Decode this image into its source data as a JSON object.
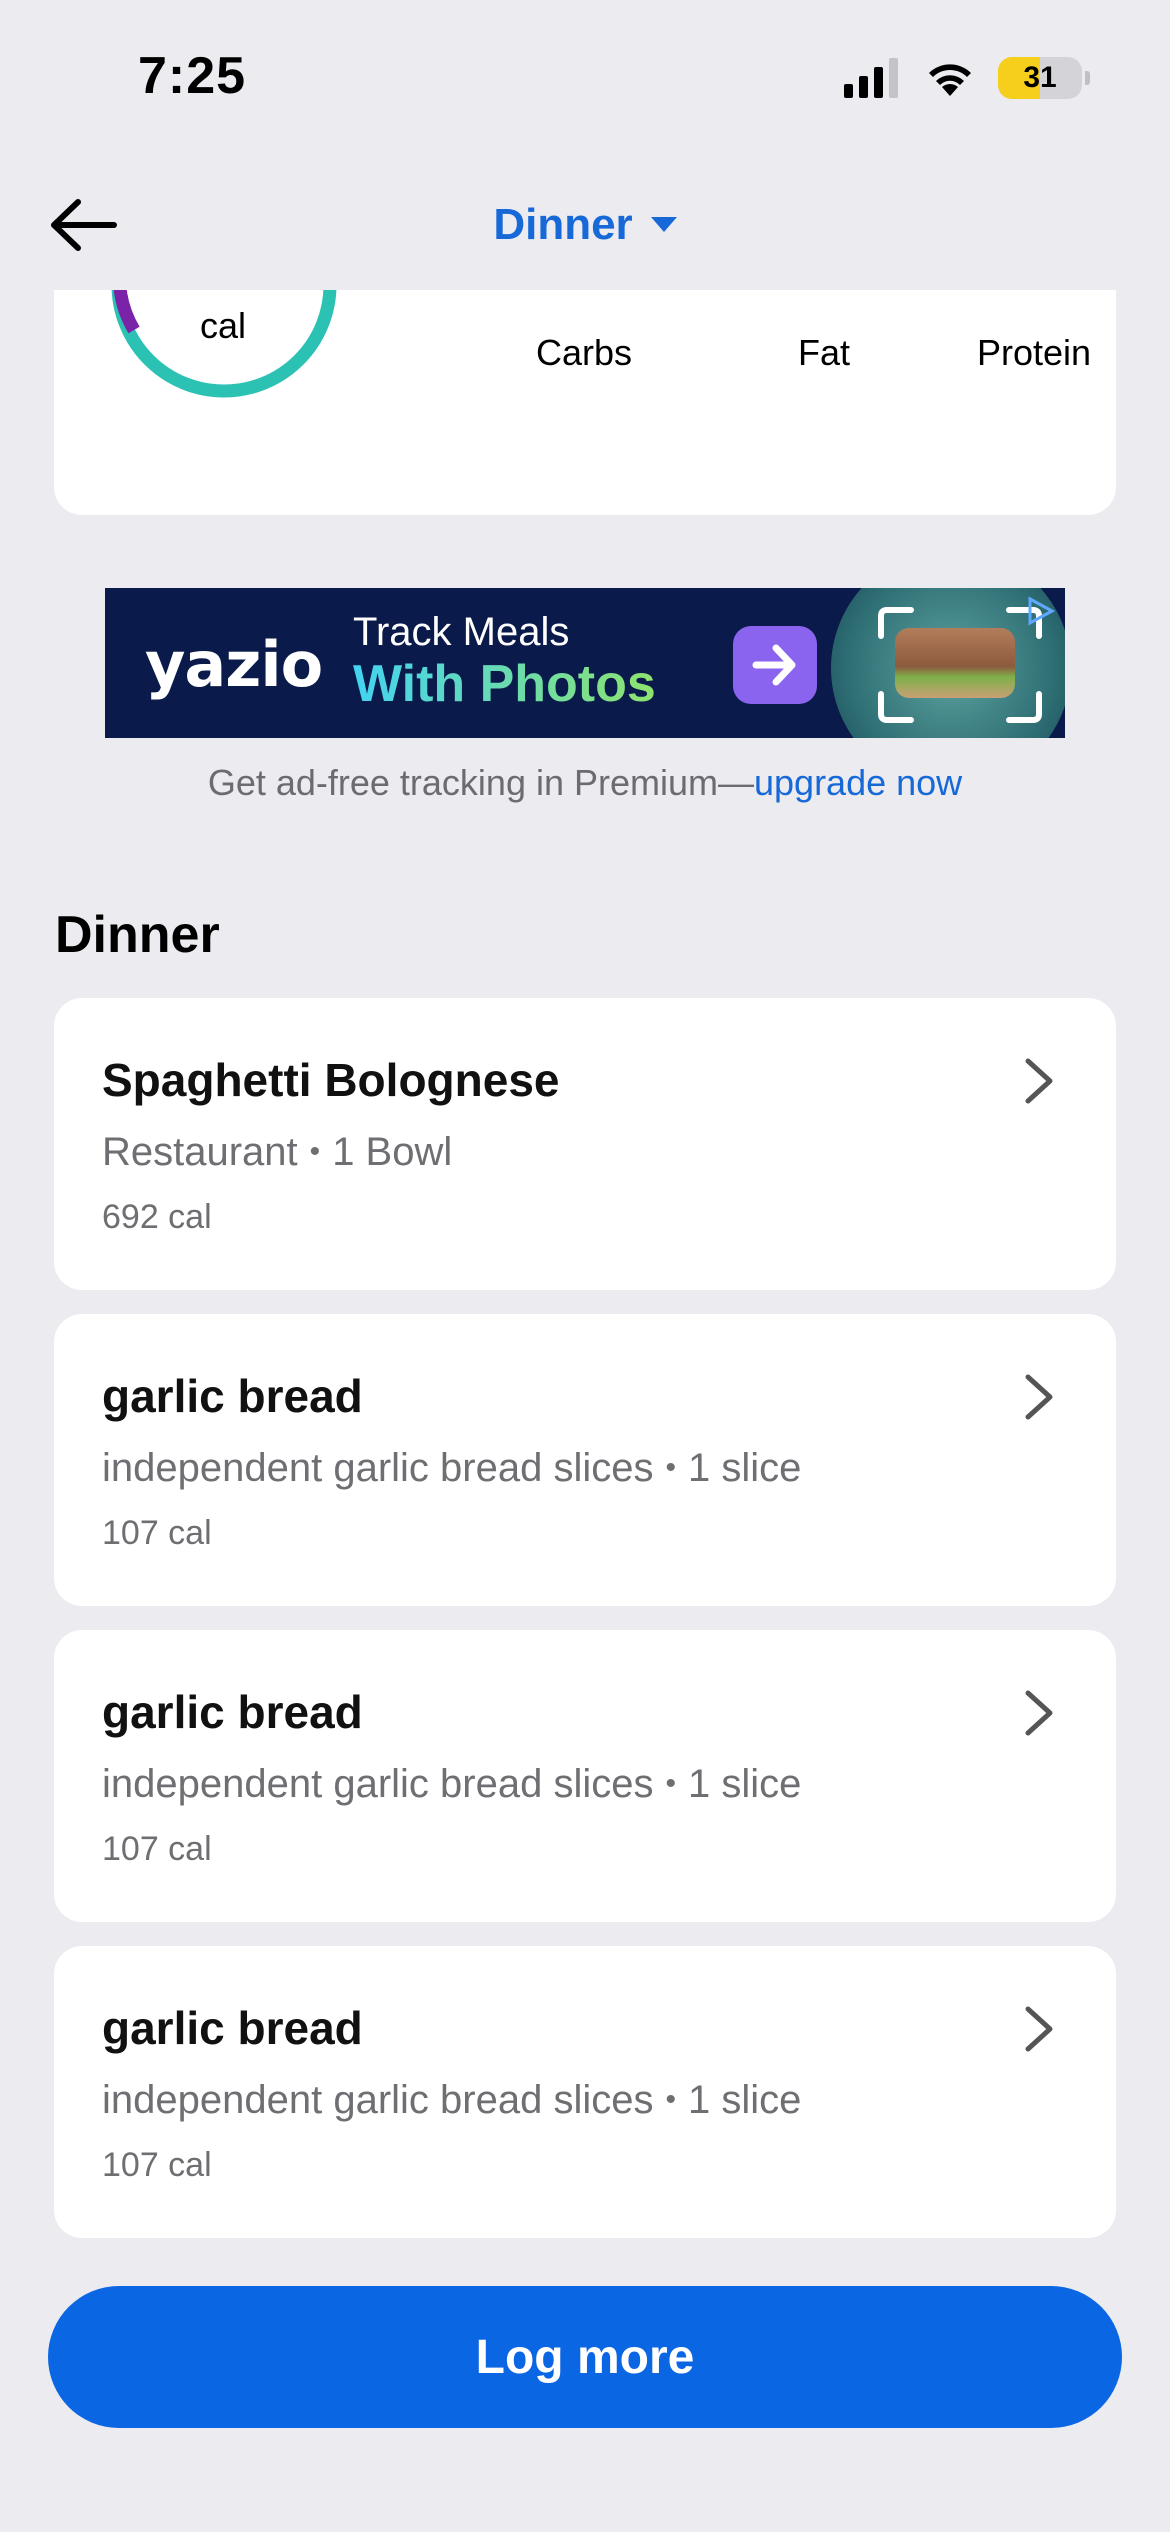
{
  "status_bar": {
    "time": "7:25",
    "battery_level": "31"
  },
  "nav": {
    "title": "Dinner"
  },
  "summary": {
    "ring_label": "cal",
    "ring_colors": {
      "track": "#2cc2b3",
      "accent": "#7b23a8"
    },
    "macros": {
      "carbs_label": "Carbs",
      "fat_label": "Fat",
      "protein_label": "Protein"
    }
  },
  "ad": {
    "logo": "yazio",
    "line1": "Track Meals",
    "line2": "With Photos",
    "caption_prefix": "Get ad-free tracking in Premium—",
    "caption_link": "upgrade now"
  },
  "section": {
    "title": "Dinner"
  },
  "meals": [
    {
      "name": "Spaghetti Bolognese",
      "source": "Restaurant",
      "serving": "1 Bowl",
      "calories": "692 cal"
    },
    {
      "name": "garlic bread",
      "source": "independent garlic bread slices",
      "serving": "1 slice",
      "calories": "107 cal"
    },
    {
      "name": "garlic bread",
      "source": "independent garlic bread slices",
      "serving": "1 slice",
      "calories": "107 cal"
    },
    {
      "name": "garlic bread",
      "source": "independent garlic bread slices",
      "serving": "1 slice",
      "calories": "107 cal"
    }
  ],
  "actions": {
    "log_more": "Log more"
  },
  "colors": {
    "accent": "#1769d8",
    "button": "#0b66e4",
    "background": "#ebebf0"
  }
}
